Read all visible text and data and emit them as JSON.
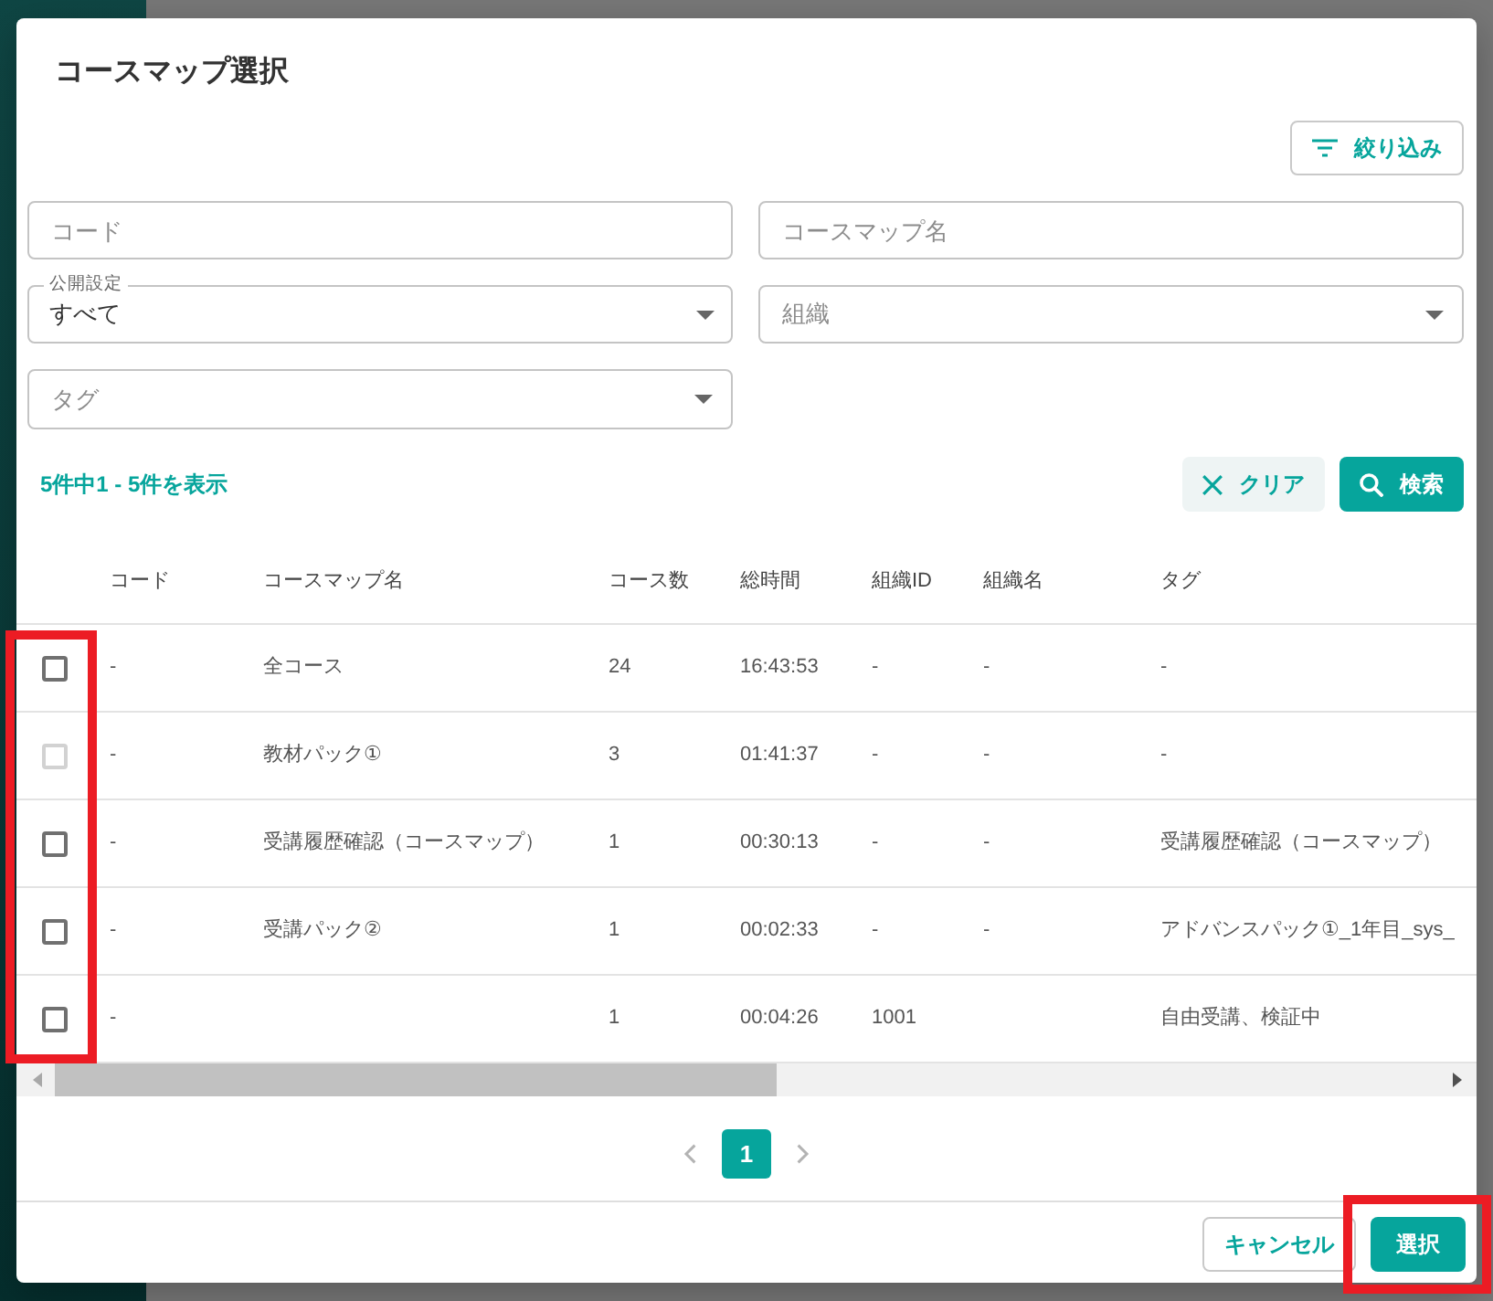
{
  "dialog": {
    "title": "コースマップ選択"
  },
  "filter_button": {
    "label": "絞り込み",
    "kind": "outline"
  },
  "filters": [
    {
      "kind": "text",
      "placeholder": "コード"
    },
    {
      "kind": "text",
      "placeholder": "コースマップ名"
    },
    {
      "kind": "select",
      "label": "公開設定",
      "value": "すべて"
    },
    {
      "kind": "select",
      "placeholder": "組織"
    },
    {
      "kind": "select",
      "placeholder": "タグ"
    }
  ],
  "result_count": "5件中1 - 5件を表示",
  "search_actions": [
    {
      "label": "クリア",
      "kind": "soft"
    },
    {
      "label": "検索",
      "kind": "primary"
    }
  ],
  "table": {
    "selection_column": {
      "highlighted": true
    },
    "columns": [
      "コード",
      "コースマップ名",
      "コース数",
      "総時間",
      "組織ID",
      "組織名",
      "タグ"
    ],
    "rows": [
      {
        "checked": false,
        "disabled": false,
        "cells": [
          "-",
          "全コース",
          "24",
          "16:43:53",
          "-",
          "-",
          "-"
        ]
      },
      {
        "checked": false,
        "disabled": true,
        "cells": [
          "-",
          "教材パック①",
          "3",
          "01:41:37",
          "-",
          "-",
          "-"
        ]
      },
      {
        "checked": false,
        "disabled": false,
        "cells": [
          "-",
          "受講履歴確認（コースマップ）",
          "1",
          "00:30:13",
          "-",
          "-",
          "受講履歴確認（コースマップ）"
        ]
      },
      {
        "checked": false,
        "disabled": false,
        "cells": [
          "-",
          "受講パック②",
          "1",
          "00:02:33",
          "-",
          "-",
          "アドバンスパック①_1年目_sys_"
        ]
      },
      {
        "checked": false,
        "disabled": false,
        "cells": [
          "-",
          null,
          "1",
          "00:04:26",
          "1001",
          null,
          "自由受講、検証中"
        ]
      }
    ]
  },
  "pagination": {
    "pages": [
      {
        "label": "1",
        "selected": true
      }
    ]
  },
  "footer_buttons": [
    {
      "label": "キャンセル",
      "kind": "outline",
      "highlighted": false
    },
    {
      "label": "選択",
      "kind": "primary",
      "highlighted": true
    }
  ]
}
